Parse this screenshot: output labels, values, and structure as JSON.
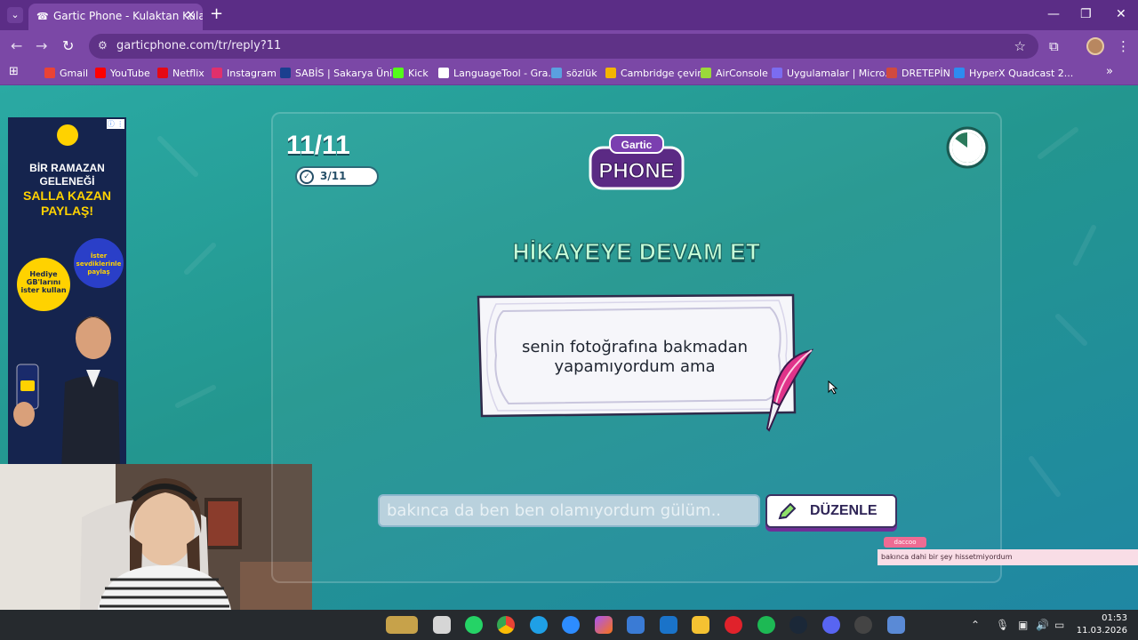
{
  "browser": {
    "tab_title": "Gartic Phone - Kulaktan Kulağa",
    "tab_close": "✕",
    "new_tab": "+",
    "url": "garticphone.com/tr/reply?11",
    "window_controls": {
      "minimize": "—",
      "maximize": "❐",
      "close": "✕"
    },
    "bookmarks": [
      {
        "label": "Gmail",
        "color": "#ea4335"
      },
      {
        "label": "YouTube",
        "color": "#ff0000"
      },
      {
        "label": "Netflix",
        "color": "#e50914"
      },
      {
        "label": "Instagram",
        "color": "#e1306c"
      },
      {
        "label": "SABİS | Sakarya Üni...",
        "color": "#1a3f8f"
      },
      {
        "label": "Kick",
        "color": "#53fc18"
      },
      {
        "label": "LanguageTool - Gra...",
        "color": "#ffffff"
      },
      {
        "label": "sözlük",
        "color": "#5aa0e0"
      },
      {
        "label": "Cambridge çeviri",
        "color": "#f4b400"
      },
      {
        "label": "AirConsole",
        "color": "#9bd93a"
      },
      {
        "label": "Uygulamalar | Micro...",
        "color": "#7b6cf0"
      },
      {
        "label": "DRETEPİN",
        "color": "#d04a3f"
      },
      {
        "label": "HyperX Quadcast 2...",
        "color": "#2d8cf0"
      }
    ],
    "more_bookmarks": "»"
  },
  "ad": {
    "line1": "BİR RAMAZAN",
    "line2": "GELENEĞİ",
    "line3": "SALLA KAZAN",
    "line4": "PAYLAŞ!",
    "bubble_left": "Hediye GB'larını ister kullan",
    "bubble_right": "İster sevdiklerinle paylaş"
  },
  "game": {
    "round": "11/11",
    "done_count": "3/11",
    "logo_top": "Gartic",
    "logo_bottom": "PHONE",
    "heading": "HİKAYEYE DEVAM ET",
    "prompt_line1": "senin fotoğrafına bakmadan",
    "prompt_line2": "yapamıyordum ama",
    "reply_value": "bakınca da ben ben olamıyordum gülüm..",
    "edit_button": "DÜZENLE",
    "timer_fraction_remaining": 0.85
  },
  "chat": {
    "username": "daccoo",
    "message": "bakınca dahi bir şey hissetmiyordum"
  },
  "taskbar": {
    "time": "01:53",
    "date": "11.03.2026"
  }
}
